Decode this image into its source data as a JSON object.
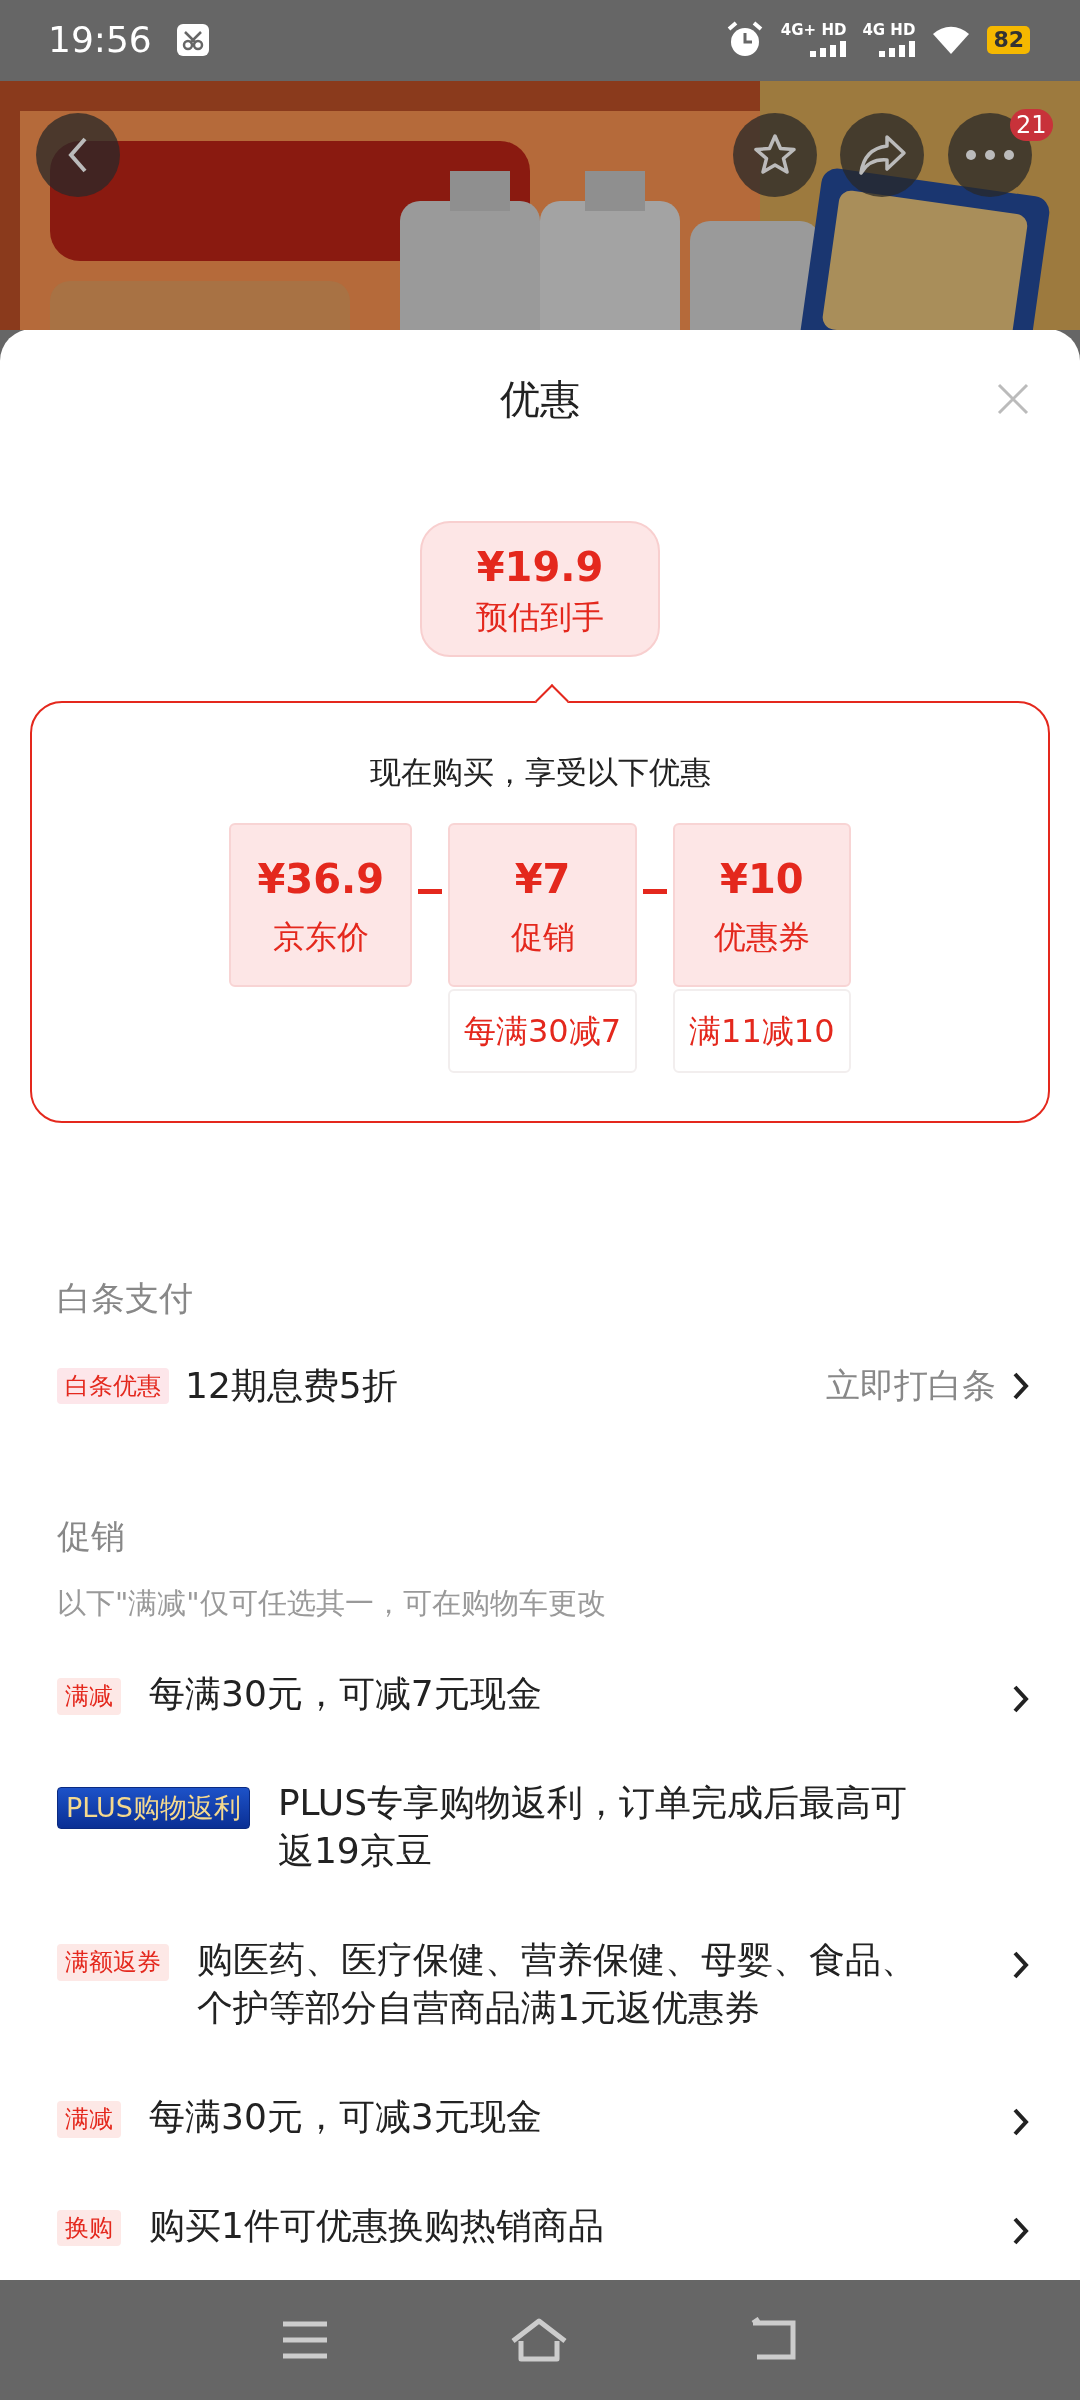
{
  "status_bar": {
    "time": "19:56",
    "networks": [
      "4G+ HD",
      "4G HD"
    ],
    "battery": "82"
  },
  "header": {
    "more_badge": "21"
  },
  "sheet": {
    "title": "优惠"
  },
  "estimate": {
    "price": "¥19.9",
    "label": "预估到手"
  },
  "breakdown": {
    "title": "现在购买，享受以下优惠",
    "items": [
      {
        "price": "¥36.9",
        "label": "京东价"
      },
      {
        "price": "¥7",
        "label": "促销",
        "note": "每满30减7"
      },
      {
        "price": "¥10",
        "label": "优惠券",
        "note": "满11减10"
      }
    ]
  },
  "baitiao": {
    "heading": "白条支付",
    "tag": "白条优惠",
    "text": "12期息费5折",
    "action": "立即打白条"
  },
  "promotions": {
    "heading": "促销",
    "note": "以下\"满减\"仅可任选其一，可在购物车更改",
    "items": [
      {
        "kind": "normal",
        "tag": "满减",
        "text": "每满30元，可减7元现金",
        "arrow": true
      },
      {
        "kind": "plus",
        "tag": "PLUS购物返利",
        "text": "PLUS专享购物返利，订单完成后最高可返19京豆",
        "arrow": false
      },
      {
        "kind": "normal",
        "tag": "满额返券",
        "text": "购医药、医疗保健、营养保健、母婴、食品、个护等部分自营商品满1元返优惠券",
        "arrow": true
      },
      {
        "kind": "normal",
        "tag": "满减",
        "text": "每满30元，可减3元现金",
        "arrow": true
      },
      {
        "kind": "normal",
        "tag": "换购",
        "text": "购买1件可优惠换购热销商品",
        "arrow": true
      }
    ]
  }
}
